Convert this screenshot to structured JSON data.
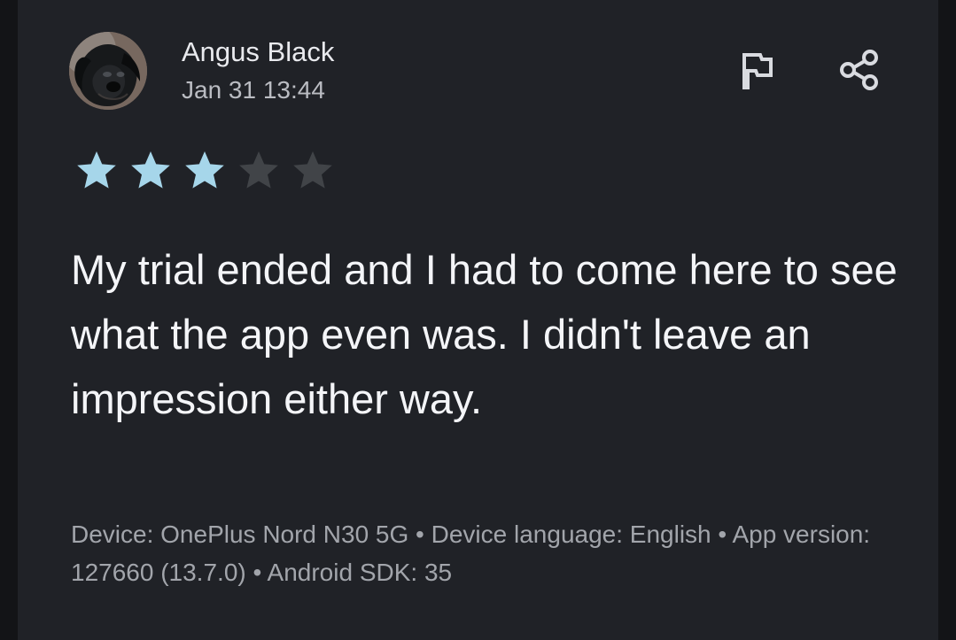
{
  "review": {
    "author": "Angus Black",
    "date": "Jan 31 13:44",
    "rating": 3,
    "max_rating": 5,
    "text": "My trial ended and I had to come here to see what the app even was. I didn't leave an impression either way.",
    "device_info": "Device: OnePlus Nord N30 5G • Device language: English • App version: 127660 (13.7.0) • Android SDK: 35"
  },
  "icons": {
    "avatar": "dog-avatar",
    "flag": "flag-icon",
    "share": "share-icon",
    "star": "star-icon"
  },
  "colors": {
    "background": "#202227",
    "outer_background": "#131417",
    "star_filled": "#a6d6ea",
    "star_empty": "#414448",
    "text_primary": "#f4f5f8",
    "text_secondary": "#babcc2",
    "metadata": "#a2a5ab"
  }
}
